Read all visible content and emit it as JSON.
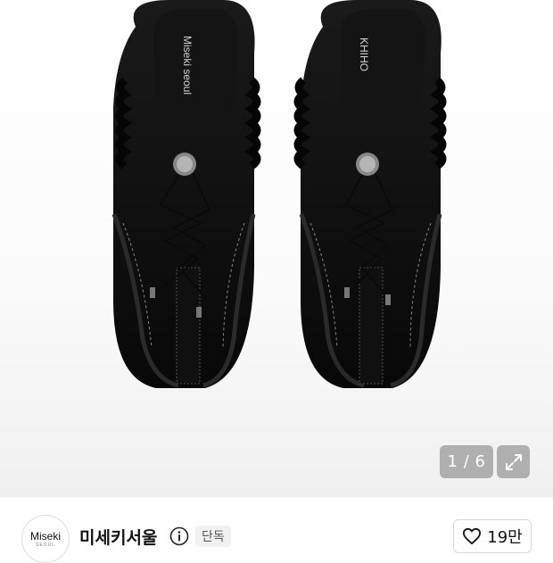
{
  "gallery": {
    "counter": "1 / 6",
    "insole_left_text": "Miseki seoul",
    "insole_right_text": "KHIHO"
  },
  "brand": {
    "logo_text": "Miseki",
    "logo_sub": "SEOUL",
    "name": "미세키서울",
    "badge": "단독",
    "like_count": "19만"
  },
  "icons": {
    "expand": "expand-icon",
    "info": "info-icon",
    "heart": "heart-icon"
  },
  "colors": {
    "shoe": "#0d0d0d",
    "badge_bg": "#f1f1f1",
    "overlay": "rgba(120,120,120,0.55)"
  }
}
